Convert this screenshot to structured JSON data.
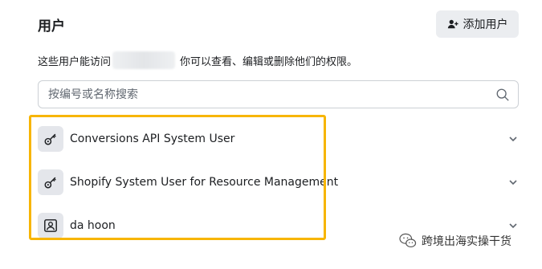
{
  "header": {
    "title": "用户",
    "add_button_label": "添加用户"
  },
  "description": {
    "before_redacted": "这些用户能访问",
    "after_redacted": "你可以查看、编辑或删除他们的权限。"
  },
  "search": {
    "placeholder": "按编号或名称搜索",
    "value": ""
  },
  "users": [
    {
      "name": "Conversions API System User",
      "icon": "key-icon"
    },
    {
      "name": "Shopify System User for Resource Management",
      "icon": "key-icon"
    },
    {
      "name": "da hoon",
      "icon": "profile-card-icon"
    }
  ],
  "highlight_color": "#f7b500",
  "watermark": {
    "text": "跨境出海实操干货",
    "icon": "wechat-icon"
  }
}
